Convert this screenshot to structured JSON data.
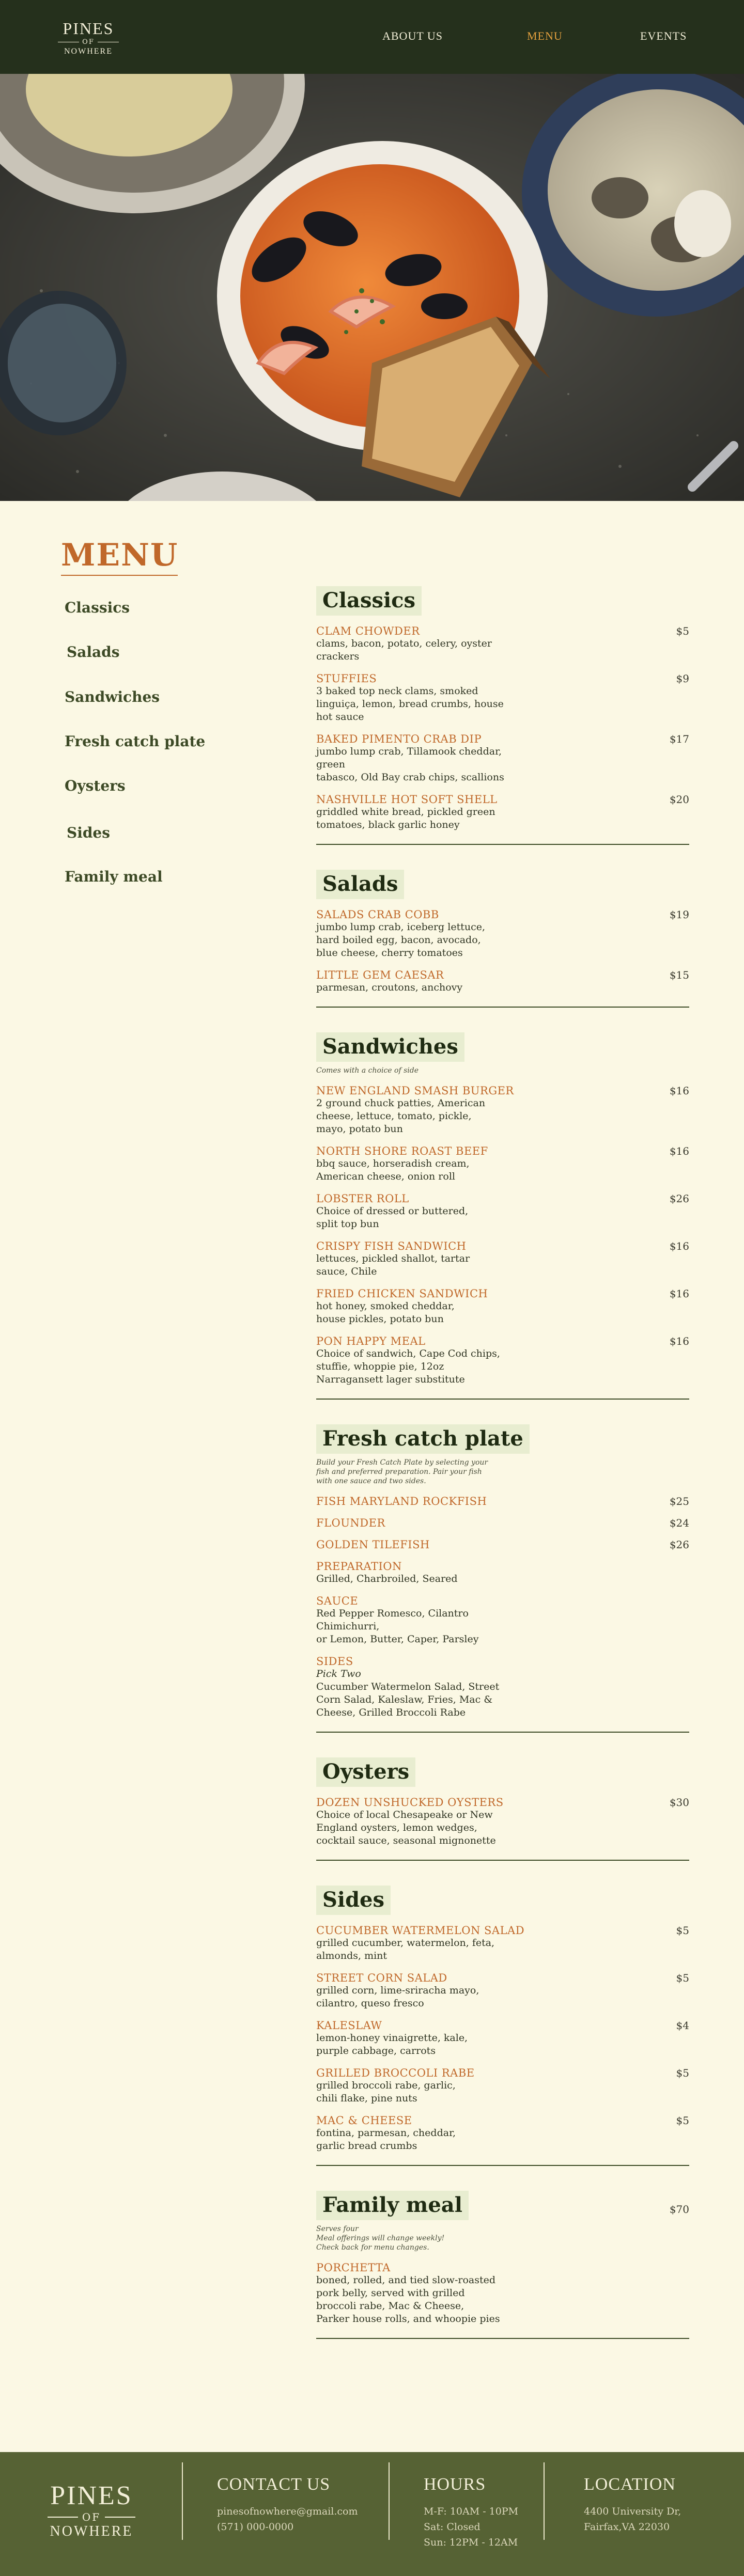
{
  "brand": {
    "line1": "PINES",
    "line2": "OF",
    "line3": "NOWHERE"
  },
  "nav": {
    "about": "ABOUT US",
    "menu": "MENU",
    "events": "EVENTS"
  },
  "menu_title": "MENU",
  "side_nav": [
    "Classics",
    "Salads",
    "Sandwiches",
    "Fresh catch plate",
    "Oysters",
    "Sides",
    "Family meal"
  ],
  "sections": [
    {
      "title": "Classics",
      "note": "",
      "price": "",
      "items": [
        {
          "name": "CLAM CHOWDER",
          "desc": "clams, bacon, potato, celery, oyster\ncrackers",
          "price": "$5"
        },
        {
          "name": "STUFFIES",
          "desc": "3 baked top neck clams, smoked\nlinguiça, lemon, bread crumbs, house\nhot sauce",
          "price": "$9"
        },
        {
          "name": "BAKED PIMENTO CRAB DIP",
          "desc": "jumbo lump crab, Tillamook cheddar, green\ntabasco, Old Bay crab chips, scallions",
          "price": "$17"
        },
        {
          "name": "NASHVILLE HOT SOFT SHELL",
          "desc": "griddled white bread, pickled green\ntomatoes, black garlic honey",
          "price": "$20"
        }
      ]
    },
    {
      "title": "Salads",
      "note": "",
      "price": "",
      "items": [
        {
          "name": "SALADS CRAB COBB",
          "desc": "jumbo lump crab, iceberg lettuce,\nhard boiled egg, bacon, avocado,\nblue cheese, cherry tomatoes",
          "price": "$19"
        },
        {
          "name": "LITTLE GEM CAESAR",
          "desc": "parmesan, croutons, anchovy",
          "price": "$15"
        }
      ]
    },
    {
      "title": "Sandwiches",
      "note": "Comes with a choice of side",
      "price": "",
      "items": [
        {
          "name": "NEW ENGLAND SMASH BURGER",
          "desc": "2 ground chuck patties, American\ncheese, lettuce, tomato, pickle,\nmayo, potato bun",
          "price": "$16"
        },
        {
          "name": "NORTH SHORE ROAST BEEF",
          "desc": "bbq sauce, horseradish cream,\nAmerican cheese, onion roll",
          "price": "$16"
        },
        {
          "name": "LOBSTER ROLL",
          "desc": "Choice of dressed or buttered,\nsplit top bun",
          "price": "$26"
        },
        {
          "name": "CRISPY FISH SANDWICH",
          "desc": "lettuces, pickled shallot, tartar\nsauce, Chile",
          "price": "$16"
        },
        {
          "name": "FRIED CHICKEN SANDWICH",
          "desc": "hot honey, smoked cheddar,\nhouse pickles, potato bun",
          "price": "$16"
        },
        {
          "name": "PON HAPPY MEAL",
          "desc": "Choice of sandwich, Cape Cod chips,\nstuffie, whoppie pie, 12oz\nNarragansett lager substitute",
          "price": "$16"
        }
      ]
    },
    {
      "title": "Fresh catch plate",
      "note": "Build your Fresh Catch Plate by selecting your\nfish and preferred preparation. Pair your fish\nwith one sauce and two sides.",
      "price": "",
      "items": [
        {
          "name": "FISH MARYLAND ROCKFISH",
          "desc": "",
          "price": "$25"
        },
        {
          "name": "FLOUNDER",
          "desc": "",
          "price": "$24"
        },
        {
          "name": "GOLDEN TILEFISH",
          "desc": "",
          "price": "$26"
        },
        {
          "name": "PREPARATION",
          "desc": "Grilled, Charbroiled, Seared",
          "price": ""
        },
        {
          "name": "SAUCE",
          "desc": "Red Pepper Romesco, Cilantro Chimichurri,\nor Lemon, Butter, Caper, Parsley",
          "price": ""
        },
        {
          "name": "SIDES",
          "sub": "Pick Two",
          "desc": "Cucumber Watermelon Salad, Street\nCorn Salad, Kaleslaw, Fries, Mac &\nCheese, Grilled Broccoli Rabe",
          "price": ""
        }
      ]
    },
    {
      "title": "Oysters",
      "note": "",
      "price": "",
      "items": [
        {
          "name": "DOZEN UNSHUCKED OYSTERS",
          "desc": "Choice of local Chesapeake or New\nEngland oysters, lemon wedges,\ncocktail sauce, seasonal mignonette",
          "price": "$30"
        }
      ]
    },
    {
      "title": "Sides",
      "note": "",
      "price": "",
      "items": [
        {
          "name": "CUCUMBER WATERMELON SALAD",
          "desc": "grilled cucumber, watermelon, feta,\nalmonds, mint",
          "price": "$5"
        },
        {
          "name": "STREET CORN SALAD",
          "desc": "grilled corn, lime-sriracha mayo,\ncilantro, queso fresco",
          "price": "$5"
        },
        {
          "name": "KALESLAW",
          "desc": "lemon-honey vinaigrette, kale,\npurple cabbage, carrots",
          "price": "$4"
        },
        {
          "name": "GRILLED BROCCOLI RABE",
          "desc": "grilled broccoli rabe, garlic,\nchili flake, pine nuts",
          "price": "$5"
        },
        {
          "name": "MAC & CHEESE",
          "desc": "fontina, parmesan, cheddar,\ngarlic bread crumbs",
          "price": "$5"
        }
      ]
    },
    {
      "title": "Family meal",
      "note": "Serves four\nMeal offerings will change weekly!\nCheck back for menu changes.",
      "price": "$70",
      "items": [
        {
          "name": "PORCHETTA",
          "desc": "boned, rolled, and tied slow-roasted\npork belly, served with grilled\nbroccoli rabe, Mac & Cheese,\nParker house rolls, and whoopie pies",
          "price": ""
        }
      ]
    }
  ],
  "footer": {
    "contact_title": "CONTACT US",
    "email": "pinesofnowhere@gmail.com",
    "phone": "(571) 000-0000",
    "hours_title": "HOURS",
    "hours": [
      "M-F: 10AM - 10PM",
      "Sat: Closed",
      "Sun: 12PM - 12AM"
    ],
    "location_title": "LOCATION",
    "address": [
      "4400 University Dr,",
      "Fairfax,VA 22030"
    ]
  },
  "colors": {
    "nav_bg": "#25301c",
    "accent": "#c0682a",
    "page_bg": "#fbf8e4",
    "footer_bg": "#566234",
    "active_nav": "#e4a03e"
  }
}
